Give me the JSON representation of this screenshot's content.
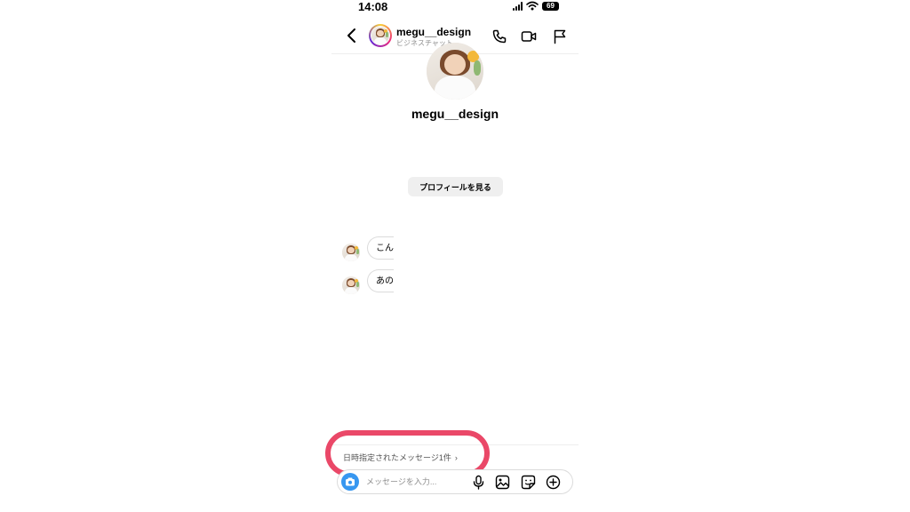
{
  "status_bar": {
    "time": "14:08",
    "battery": "69",
    "icons": [
      "cellular-signal-icon",
      "wifi-icon",
      "battery-icon"
    ]
  },
  "header": {
    "username": "megu__design",
    "subtitle": "ビジネスチャット",
    "icons": [
      "back-chevron-icon",
      "phone-icon",
      "video-camera-icon",
      "flag-icon"
    ]
  },
  "profile": {
    "name": "megu__design",
    "view_profile_label": "プロフィールを見る"
  },
  "messages": [
    {
      "text": "こん"
    },
    {
      "text": "あの"
    }
  ],
  "scheduled": {
    "label": "日時指定されたメッセージ1件",
    "chevron": "›"
  },
  "composer": {
    "placeholder": "メッセージを入力...",
    "icons": [
      "camera-icon",
      "microphone-icon",
      "gallery-icon",
      "sticker-icon",
      "plus-circle-icon"
    ]
  },
  "colors": {
    "accent_blue": "#3797f0",
    "highlight_pink": "#ea4868",
    "button_gray": "#efefef"
  }
}
